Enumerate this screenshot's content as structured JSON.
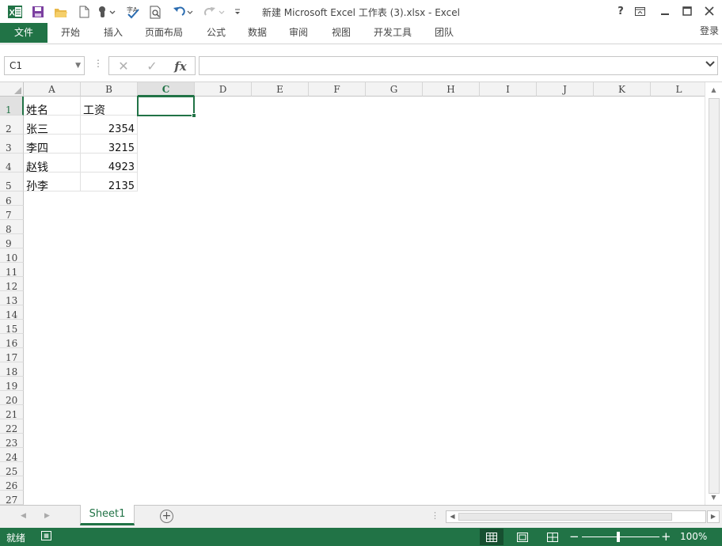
{
  "window": {
    "title": "新建 Microsoft Excel 工作表 (3).xlsx - Excel",
    "help": "?",
    "restore_ribbon": "⊡",
    "minimize": "—",
    "maximize": "☐",
    "close": "✕"
  },
  "quick_access": [
    {
      "icon": "excel-logo-icon",
      "glyph": "X"
    },
    {
      "icon": "save-icon",
      "glyph": "💾"
    },
    {
      "icon": "open-folder-icon",
      "glyph": "📂"
    },
    {
      "icon": "new-document-icon",
      "glyph": "🗋"
    },
    {
      "icon": "touch-mode-icon",
      "glyph": "☝"
    },
    {
      "icon": "spelling-icon",
      "glyph": "ABC"
    },
    {
      "icon": "print-preview-icon",
      "glyph": "🔍"
    },
    {
      "icon": "undo-icon",
      "glyph": "↶"
    },
    {
      "icon": "redo-icon",
      "glyph": "↷"
    },
    {
      "icon": "customize-toolbar-icon",
      "glyph": "▾"
    }
  ],
  "ribbon": {
    "tabs": [
      "文件",
      "开始",
      "插入",
      "页面布局",
      "公式",
      "数据",
      "审阅",
      "视图",
      "开发工具",
      "团队"
    ],
    "login": "登录"
  },
  "formula_bar": {
    "name_box": "C1",
    "formula": "",
    "fx": "fx"
  },
  "sheet": {
    "columns": [
      "A",
      "B",
      "C",
      "D",
      "E",
      "F",
      "G",
      "H",
      "I",
      "J",
      "K",
      "L"
    ],
    "rows": [
      "1",
      "2",
      "3",
      "4",
      "5",
      "6",
      "7",
      "8",
      "9",
      "10",
      "11",
      "12",
      "13",
      "14",
      "15",
      "16",
      "17",
      "18",
      "19",
      "20",
      "21",
      "22",
      "23",
      "24",
      "25",
      "26",
      "27"
    ],
    "selected_column": "C",
    "selected_row": "1",
    "cells": [
      [
        "姓名",
        "工资"
      ],
      [
        "张三",
        "2354"
      ],
      [
        "李四",
        "3215"
      ],
      [
        "赵钱",
        "4923"
      ],
      [
        "孙李",
        "2135"
      ]
    ]
  },
  "sheet_tabs": {
    "tabs": [
      "Sheet1"
    ],
    "add": "+"
  },
  "status_bar": {
    "ready": "就绪",
    "zoom": "100%",
    "zoom_minus": "−",
    "zoom_plus": "+"
  },
  "colors": {
    "accent": "#217346",
    "title_text": "#444444"
  }
}
